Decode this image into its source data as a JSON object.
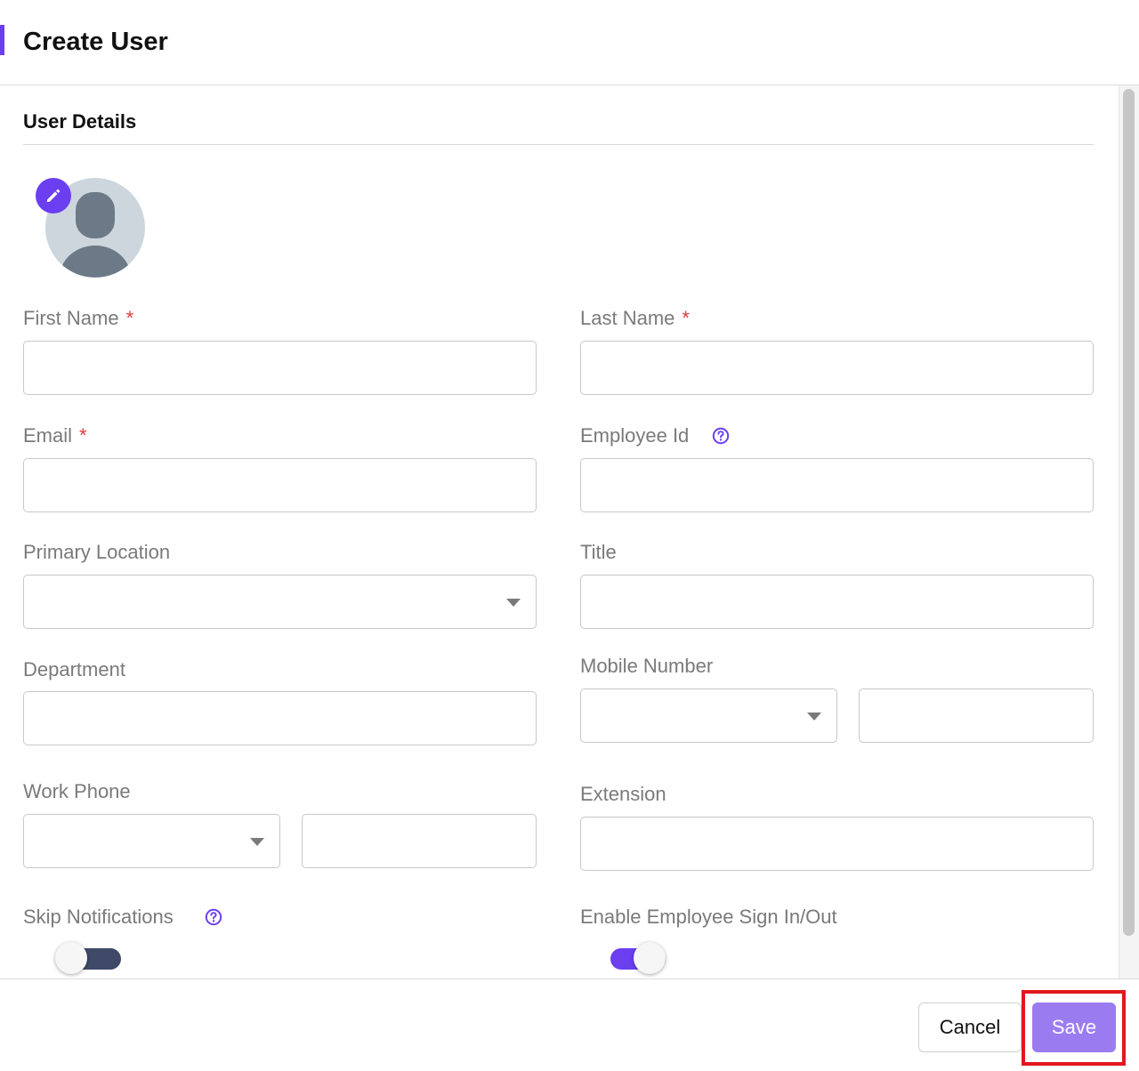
{
  "page": {
    "title": "Create User"
  },
  "section": {
    "title": "User Details"
  },
  "avatar": {
    "edit_icon": "pencil-icon",
    "placeholder_icon": "user-silhouette-icon"
  },
  "fields": {
    "first_name": {
      "label": "First Name",
      "required_mark": "*",
      "value": ""
    },
    "last_name": {
      "label": "Last Name",
      "required_mark": "*",
      "value": ""
    },
    "email": {
      "label": "Email",
      "required_mark": "*",
      "value": ""
    },
    "employee_id": {
      "label": "Employee Id",
      "help_icon": "question-circle-icon",
      "value": ""
    },
    "primary_location": {
      "label": "Primary Location",
      "selected": ""
    },
    "title": {
      "label": "Title",
      "value": ""
    },
    "department": {
      "label": "Department",
      "value": ""
    },
    "mobile_number": {
      "label": "Mobile Number",
      "country_code": "",
      "value": ""
    },
    "work_phone": {
      "label": "Work Phone",
      "country_code": "",
      "value": ""
    },
    "extension": {
      "label": "Extension",
      "value": ""
    }
  },
  "toggles": {
    "skip_notifications": {
      "label": "Skip Notifications",
      "help_icon": "question-circle-icon",
      "on": false
    },
    "enable_sign_in_out": {
      "label": "Enable Employee Sign In/Out",
      "on": true
    }
  },
  "footer": {
    "cancel_label": "Cancel",
    "save_label": "Save"
  },
  "colors": {
    "accent": "#6b3ff0",
    "save_button": "#9b7cf0",
    "required": "#e03a3a",
    "toggle_off_track": "#3e4a68",
    "highlight": "#e0181e"
  }
}
